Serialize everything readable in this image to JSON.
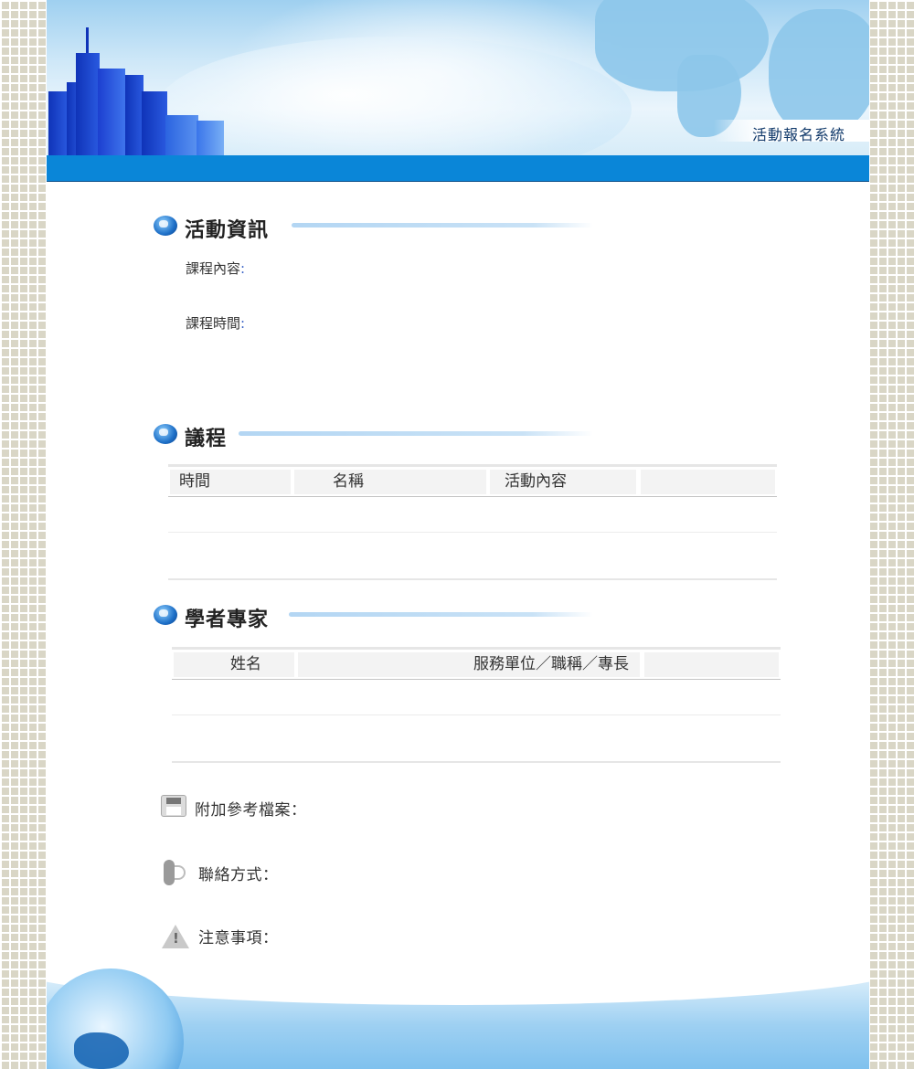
{
  "header": {
    "system_title": "活動報名系統"
  },
  "activity_info": {
    "title": "活動資訊",
    "course_content_label": "課程內容",
    "course_time_label": "課程時間",
    "colon": ":"
  },
  "agenda": {
    "title": "議程",
    "columns": [
      "時間",
      "名稱",
      "活動內容",
      ""
    ]
  },
  "experts": {
    "title": "學者專家",
    "columns": [
      "姓名",
      "服務單位／職稱／專長",
      ""
    ]
  },
  "attachments": {
    "label": "附加參考檔案："
  },
  "contact": {
    "label": "聯絡方式："
  },
  "notice": {
    "label": "注意事項："
  },
  "icons": {
    "section": "globe-icon",
    "attachments": "floppy-disk-icon",
    "contact": "phone-icon",
    "notice": "warning-icon"
  },
  "colors": {
    "navbar": "#0a86d8",
    "accent_line": "#b3d6f3",
    "label_colon": "#3a62c6"
  }
}
